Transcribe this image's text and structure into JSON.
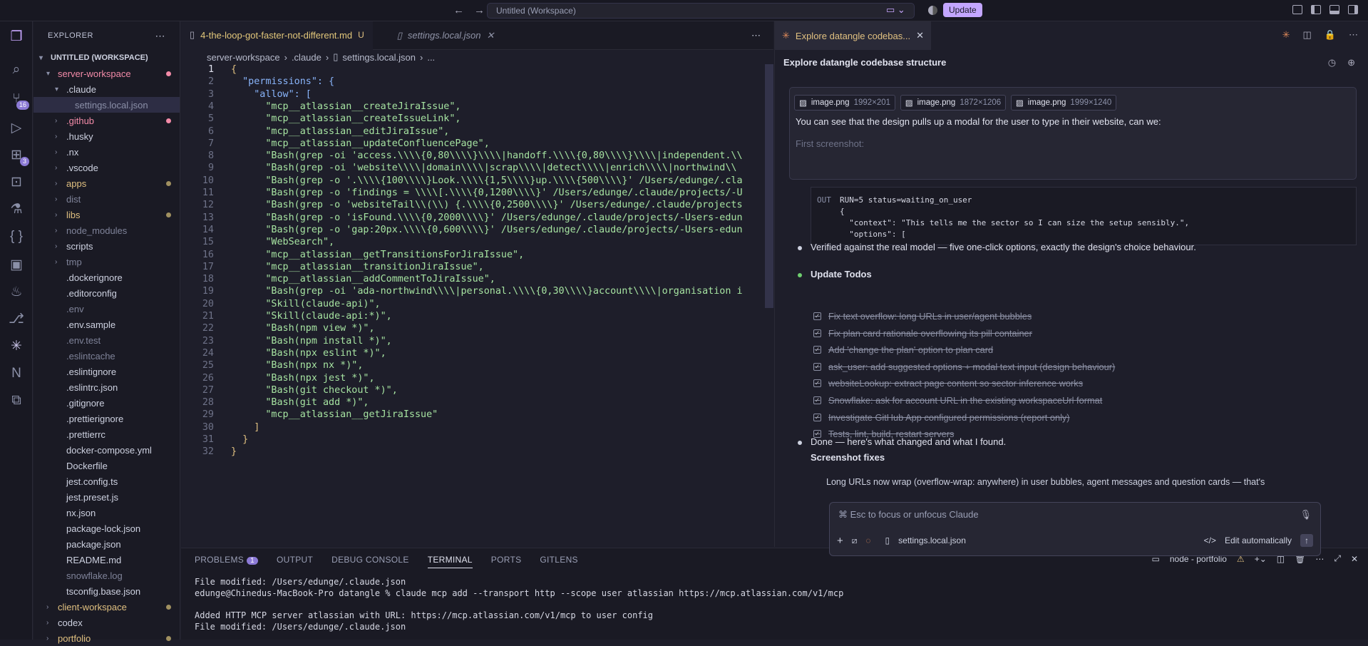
{
  "titlebar": {
    "search": "Untitled (Workspace)",
    "update": "Update"
  },
  "activity": {
    "scm_badge": "16",
    "ext_badge": "3"
  },
  "explorer": {
    "header": "EXPLORER",
    "workspace": "UNTITLED (WORKSPACE)",
    "items": [
      {
        "label": "server-workspace",
        "color": "#f38ba8",
        "indent": 1,
        "chev": "▾",
        "dot": "#f38ba8"
      },
      {
        "label": ".claude",
        "color": "#cdd1e0",
        "indent": 2,
        "chev": "▾"
      },
      {
        "label": "settings.local.json",
        "color": "#8b90a8",
        "indent": 3,
        "sel": true
      },
      {
        "label": ".github",
        "color": "#f38ba8",
        "indent": 2,
        "chev": "›",
        "dot": "#f38ba8"
      },
      {
        "label": ".husky",
        "color": "#cdd1e0",
        "indent": 2,
        "chev": "›"
      },
      {
        "label": ".nx",
        "color": "#cdd1e0",
        "indent": 2,
        "chev": "›"
      },
      {
        "label": ".vscode",
        "color": "#cdd1e0",
        "indent": 2,
        "chev": "›"
      },
      {
        "label": "apps",
        "color": "#e0c080",
        "indent": 2,
        "chev": "›",
        "dot": "#a09060"
      },
      {
        "label": "dist",
        "color": "#7f8399",
        "indent": 2,
        "chev": "›"
      },
      {
        "label": "libs",
        "color": "#e0c080",
        "indent": 2,
        "chev": "›",
        "dot": "#a09060"
      },
      {
        "label": "node_modules",
        "color": "#7f8399",
        "indent": 2,
        "chev": "›"
      },
      {
        "label": "scripts",
        "color": "#cdd1e0",
        "indent": 2,
        "chev": "›"
      },
      {
        "label": "tmp",
        "color": "#7f8399",
        "indent": 2,
        "chev": "›"
      },
      {
        "label": ".dockerignore",
        "color": "#cdd1e0",
        "indent": 2
      },
      {
        "label": ".editorconfig",
        "color": "#cdd1e0",
        "indent": 2
      },
      {
        "label": ".env",
        "color": "#7f8399",
        "indent": 2
      },
      {
        "label": ".env.sample",
        "color": "#cdd1e0",
        "indent": 2
      },
      {
        "label": ".env.test",
        "color": "#7f8399",
        "indent": 2
      },
      {
        "label": ".eslintcache",
        "color": "#7f8399",
        "indent": 2
      },
      {
        "label": ".eslintignore",
        "color": "#cdd1e0",
        "indent": 2
      },
      {
        "label": ".eslintrc.json",
        "color": "#cdd1e0",
        "indent": 2
      },
      {
        "label": ".gitignore",
        "color": "#cdd1e0",
        "indent": 2
      },
      {
        "label": ".prettierignore",
        "color": "#cdd1e0",
        "indent": 2
      },
      {
        "label": ".prettierrc",
        "color": "#cdd1e0",
        "indent": 2
      },
      {
        "label": "docker-compose.yml",
        "color": "#cdd1e0",
        "indent": 2
      },
      {
        "label": "Dockerfile",
        "color": "#cdd1e0",
        "indent": 2
      },
      {
        "label": "jest.config.ts",
        "color": "#cdd1e0",
        "indent": 2
      },
      {
        "label": "jest.preset.js",
        "color": "#cdd1e0",
        "indent": 2
      },
      {
        "label": "nx.json",
        "color": "#cdd1e0",
        "indent": 2
      },
      {
        "label": "package-lock.json",
        "color": "#cdd1e0",
        "indent": 2
      },
      {
        "label": "package.json",
        "color": "#cdd1e0",
        "indent": 2
      },
      {
        "label": "README.md",
        "color": "#cdd1e0",
        "indent": 2
      },
      {
        "label": "snowflake.log",
        "color": "#7f8399",
        "indent": 2
      },
      {
        "label": "tsconfig.base.json",
        "color": "#cdd1e0",
        "indent": 2
      },
      {
        "label": "client-workspace",
        "color": "#e0c080",
        "indent": 1,
        "chev": "›",
        "dot": "#a09060"
      },
      {
        "label": "codex",
        "color": "#cdd1e0",
        "indent": 1,
        "chev": "›"
      },
      {
        "label": "portfolio",
        "color": "#e0c080",
        "indent": 1,
        "chev": "›",
        "dot": "#a09060"
      }
    ]
  },
  "editor": {
    "tab1": "4-the-loop-got-faster-not-different.md",
    "tab1_status": "U",
    "tab2": "settings.local.json",
    "breadcrumb": [
      "server-workspace",
      ".claude",
      "settings.local.json",
      "..."
    ],
    "lines": [
      "{",
      "  \"permissions\": {",
      "    \"allow\": [",
      "      \"mcp__atlassian__createJiraIssue\",",
      "      \"mcp__atlassian__createIssueLink\",",
      "      \"mcp__atlassian__editJiraIssue\",",
      "      \"mcp__atlassian__updateConfluencePage\",",
      "      \"Bash(grep -oi 'access.\\\\\\\\{0,80\\\\\\\\}\\\\\\\\|handoff.\\\\\\\\{0,80\\\\\\\\}\\\\\\\\|independent.\\\\",
      "      \"Bash(grep -oi 'website\\\\\\\\|domain\\\\\\\\|scrap\\\\\\\\|detect\\\\\\\\|enrich\\\\\\\\|northwind\\\\",
      "      \"Bash(grep -o '.\\\\\\\\{100\\\\\\\\}Look.\\\\\\\\{1,5\\\\\\\\}up.\\\\\\\\{500\\\\\\\\}' /Users/edunge/.cla",
      "      \"Bash(grep -o 'findings = \\\\\\\\[.\\\\\\\\{0,1200\\\\\\\\}' /Users/edunge/.claude/projects/-U",
      "      \"Bash(grep -o 'websiteTail\\\\(\\\\) {.\\\\\\\\{0,2500\\\\\\\\}' /Users/edunge/.claude/projects",
      "      \"Bash(grep -o 'isFound.\\\\\\\\{0,2000\\\\\\\\}' /Users/edunge/.claude/projects/-Users-edun",
      "      \"Bash(grep -o 'gap:20px.\\\\\\\\{0,600\\\\\\\\}' /Users/edunge/.claude/projects/-Users-edun",
      "      \"WebSearch\",",
      "      \"mcp__atlassian__getTransitionsForJiraIssue\",",
      "      \"mcp__atlassian__transitionJiraIssue\",",
      "      \"mcp__atlassian__addCommentToJiraIssue\",",
      "      \"Bash(grep -oi 'ada-northwind\\\\\\\\|personal.\\\\\\\\{0,30\\\\\\\\}account\\\\\\\\|organisation i",
      "      \"Skill(claude-api)\",",
      "      \"Skill(claude-api:*)\",",
      "      \"Bash(npm view *)\",",
      "      \"Bash(npm install *)\",",
      "      \"Bash(npx eslint *)\",",
      "      \"Bash(npx nx *)\",",
      "      \"Bash(npx jest *)\",",
      "      \"Bash(git checkout *)\",",
      "      \"Bash(git add *)\",",
      "      \"mcp__atlassian__getJiraIssue\"",
      "    ]",
      "  }",
      "}"
    ]
  },
  "panel": {
    "problems": "PROBLEMS",
    "problems_count": "1",
    "output": "OUTPUT",
    "debug": "DEBUG CONSOLE",
    "terminal": "TERMINAL",
    "ports": "PORTS",
    "gitlens": "GITLENS",
    "term_name": "node - portfolio",
    "terminal_text": "File modified: /Users/edunge/.claude.json\nedunge@Chinedus-MacBook-Pro datangle % claude mcp add --transport http --scope user atlassian https://mcp.atlassian.com/v1/mcp\n\nAdded HTTP MCP server atlassian with URL: https://mcp.atlassian.com/v1/mcp to user config\nFile modified: /Users/edunge/.claude.json"
  },
  "claude": {
    "tab": "Explore datangle codebas...",
    "title": "Explore datangle codebase structure",
    "chips": [
      {
        "name": "image.png",
        "size": "1992×201"
      },
      {
        "name": "image.png",
        "size": "1872×1206"
      },
      {
        "name": "image.png",
        "size": "1999×1240"
      }
    ],
    "message": "You can see that the design pulls up a modal for the user to type in their website, can we:",
    "message_more": "First screenshot:",
    "out_label": "OUT",
    "out_text": "RUN=5 status=waiting_on_user\n{\n  \"context\": \"This tells me the sector so I can size the setup sensibly.\",\n  \"options\": [",
    "verified": "Verified against the real model — five one-click options, exactly the design's choice behaviour.",
    "todos_title": "Update Todos",
    "todos": [
      "Fix text overflow: long URLs in user/agent bubbles",
      "Fix plan card rationale overflowing its pill container",
      "Add 'change the plan' option to plan card",
      "ask_user: add suggested options + modal text input (design behaviour)",
      "websiteLookup: extract page content so sector inference works",
      "Snowflake: ask for account URL in the existing workspaceUrl format",
      "Investigate GitHub App configured permissions (report only)",
      "Tests, lint, build, restart servers"
    ],
    "done": "Done — here's what changed and what I found.",
    "fixes_title": "Screenshot fixes",
    "fix_item": "Long URLs now wrap (overflow-wrap: anywhere) in user bubbles, agent messages and question cards — that's",
    "prompt_placeholder": "⌘ Esc to focus or unfocus Claude",
    "prompt_file": "settings.local.json",
    "edit_mode": "Edit automatically"
  }
}
